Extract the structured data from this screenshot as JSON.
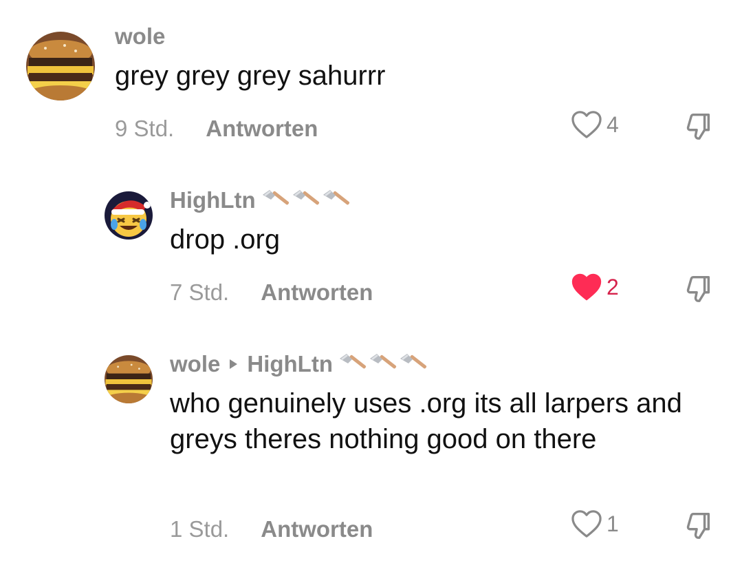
{
  "comments": [
    {
      "username": "wole",
      "text": "grey grey grey sahurrr",
      "time": "9 Std.",
      "reply_label": "Antworten",
      "likes": "4",
      "liked": false,
      "avatar_icon": "burger-avatar-icon"
    },
    {
      "username": "HighLtn",
      "badges": [
        "hammer",
        "hammer",
        "hammer"
      ],
      "text": "drop .org",
      "time": "7 Std.",
      "reply_label": "Antworten",
      "likes": "2",
      "liked": true,
      "avatar_icon": "santa-laughing-emoji-avatar-icon"
    },
    {
      "username": "wole",
      "reply_to": "HighLtn",
      "badges": [
        "hammer",
        "hammer",
        "hammer"
      ],
      "text": "who genuinely uses .org its all larpers and greys theres nothing good on there",
      "time": "1 Std.",
      "reply_label": "Antworten",
      "likes": "1",
      "liked": false,
      "avatar_icon": "burger-avatar-icon"
    }
  ],
  "colors": {
    "username": "#8a8a8a",
    "text": "#111111",
    "time": "#9a9a9a",
    "like_active": "#fe2c55"
  }
}
